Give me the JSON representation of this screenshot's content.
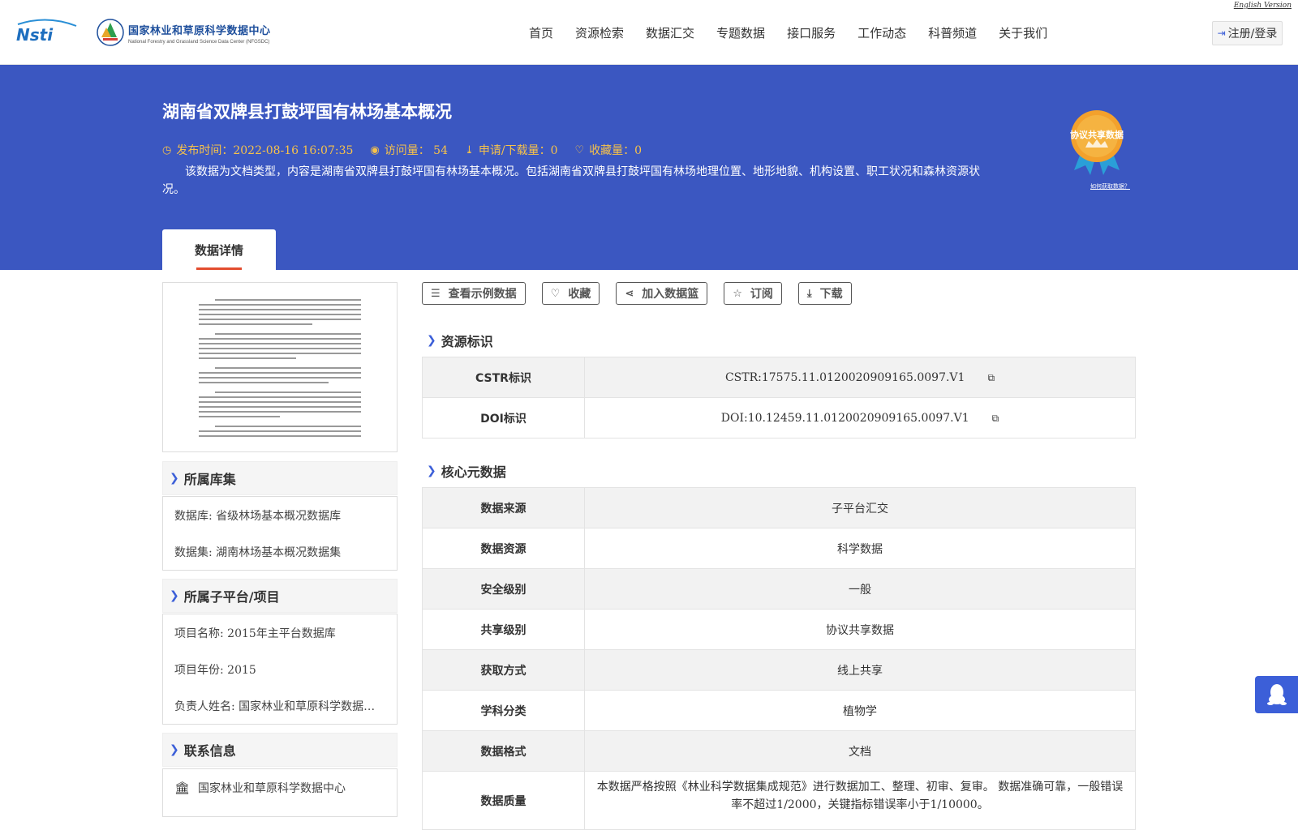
{
  "header": {
    "english_link": "English Version",
    "logo_nsti": "Nsti",
    "logo_cn": "国家林业和草原科学数据中心",
    "logo_en": "National Forestry and Grassland Science Data Center (NFGSDC)",
    "nav": [
      "首页",
      "资源检索",
      "数据汇交",
      "专题数据",
      "接口服务",
      "工作动态",
      "科普频道",
      "关于我们"
    ],
    "login": "注册/登录"
  },
  "banner": {
    "title": "湖南省双牌县打鼓坪国有林场基本概况",
    "publish": "发布时间：2022-08-16 16:07:35",
    "visits": "访问量： 54",
    "downloads": "申请/下载量：0",
    "favorites": "收藏量：0",
    "description": "该数据为文档类型，内容是湖南省双牌县打鼓坪国有林场基本概况。包括湖南省双牌县打鼓坪国有林场地理位置、地形地貌、机构设置、职工状况和森林资源状况。",
    "badge_text": "协议共享数据",
    "how_link": "如何获取数据？",
    "tab": "数据详情"
  },
  "sidebar": {
    "library_title": "所属库集",
    "library_rows": [
      "数据库: 省级林场基本概况数据库",
      "数据集: 湖南林场基本概况数据集"
    ],
    "project_title": "所属子平台/项目",
    "project_rows": [
      "项目名称: 2015年主平台数据库",
      "项目年份: 2015",
      "负责人姓名: 国家林业和草原科学数据…"
    ],
    "contact_title": "联系信息",
    "contact_rows": [
      "国家林业和草原科学数据中心"
    ]
  },
  "actions": [
    "查看示例数据",
    "收藏",
    "加入数据篮",
    "订阅",
    "下载"
  ],
  "resource_id": {
    "title": "资源标识",
    "rows": [
      {
        "k": "CSTR标识",
        "v": "CSTR:17575.11.0120020909165.0097.V1"
      },
      {
        "k": "DOI标识",
        "v": "DOI:10.12459.11.0120020909165.0097.V1"
      }
    ]
  },
  "core_meta": {
    "title": "核心元数据",
    "rows": [
      {
        "k": "数据来源",
        "v": "子平台汇交"
      },
      {
        "k": "数据资源",
        "v": "科学数据"
      },
      {
        "k": "安全级别",
        "v": "一般"
      },
      {
        "k": "共享级别",
        "v": "协议共享数据"
      },
      {
        "k": "获取方式",
        "v": "线上共享"
      },
      {
        "k": "学科分类",
        "v": "植物学"
      },
      {
        "k": "数据格式",
        "v": "文档"
      },
      {
        "k": "数据质量",
        "v": "本数据严格按照《林业科学数据集成规范》进行数据加工、整理、初审、复审。 数据准确可靠，一般错误率不超过1/2000，关键指标错误率小于1/10000。"
      }
    ]
  },
  "colors": {
    "banner": "#3b57c1",
    "accent": "#f7c24a",
    "link_blue": "#3c5fd8",
    "tab_underline": "#e34d2f"
  }
}
